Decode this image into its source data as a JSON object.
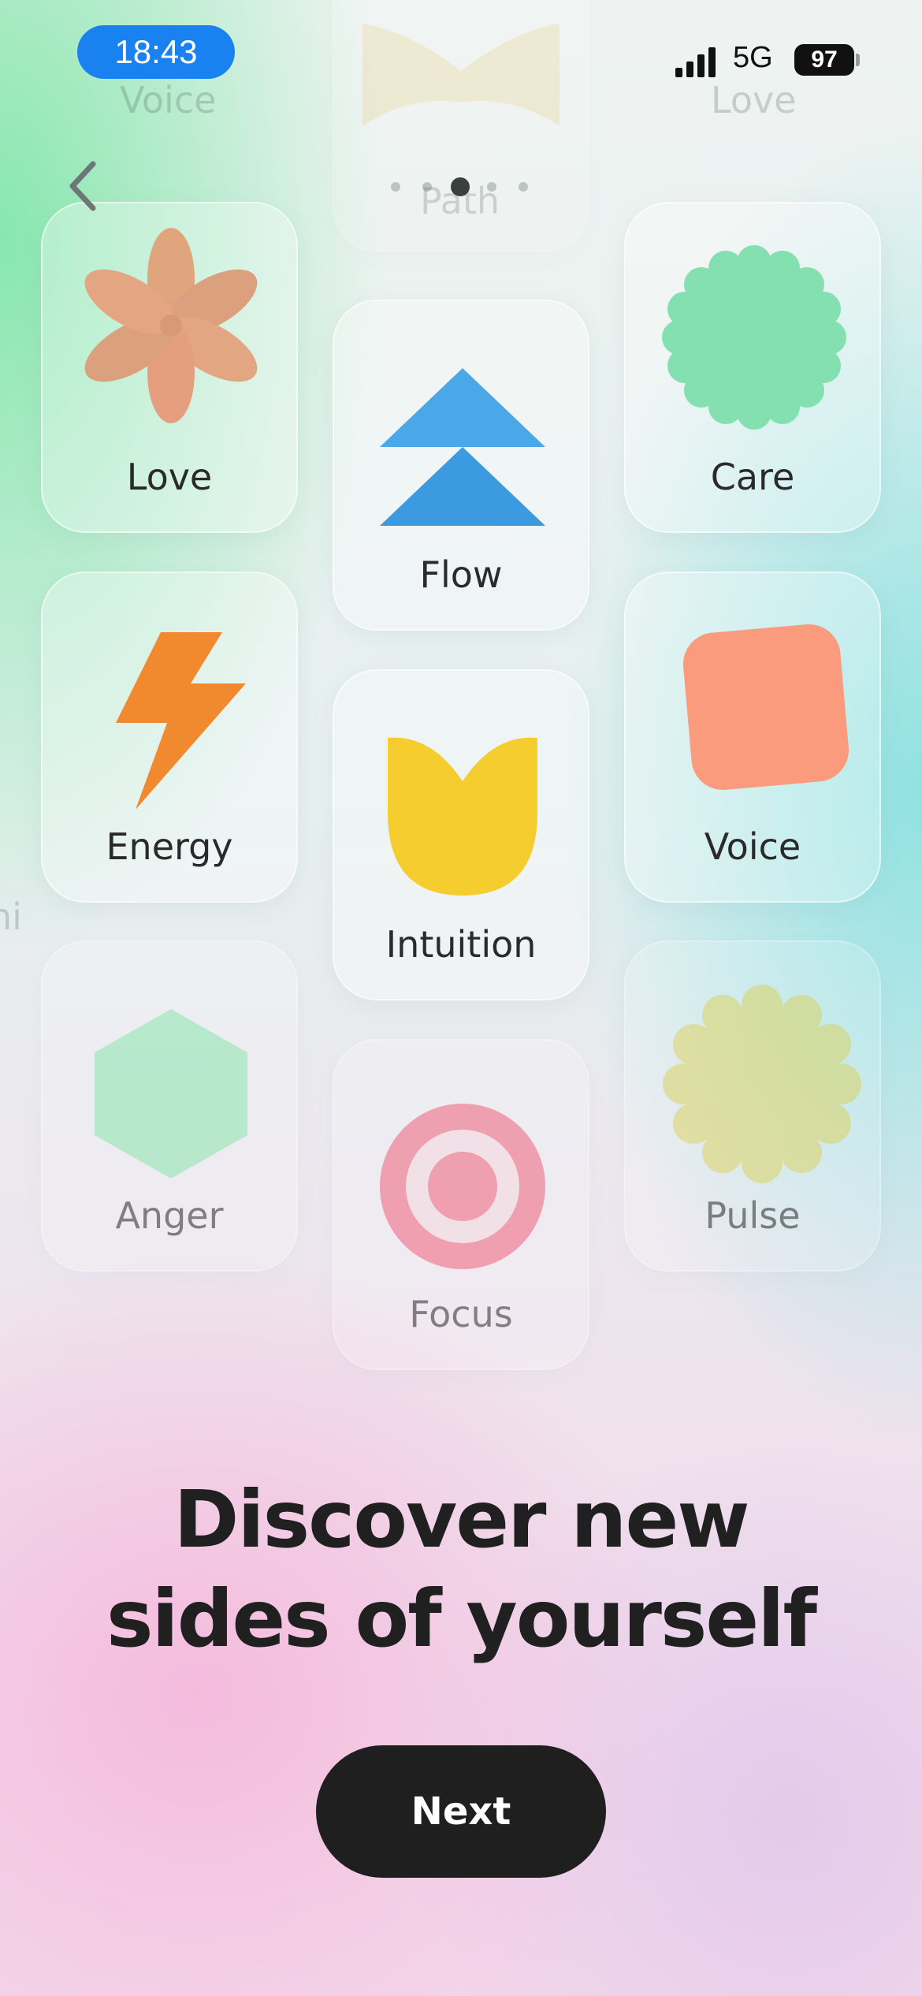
{
  "status_bar": {
    "time": "18:43",
    "network": "5G",
    "battery": "97"
  },
  "nav": {
    "back_icon": "chevron-left-icon",
    "page_count": 5,
    "active_page": 2
  },
  "ghost_labels": {
    "top_left": "Voice",
    "top_center": "Path",
    "top_right": "Love",
    "left_edge": "hi"
  },
  "cards": [
    {
      "id": "love",
      "label": "Love",
      "icon": "flower-icon",
      "color": "#e5a07a"
    },
    {
      "id": "flow",
      "label": "Flow",
      "icon": "double-triangle-icon",
      "color": "#3aa3e6"
    },
    {
      "id": "care",
      "label": "Care",
      "icon": "scalloped-circle-icon",
      "color": "#7fdcae"
    },
    {
      "id": "energy",
      "label": "Energy",
      "icon": "lightning-bolt-icon",
      "color": "#f08a2e"
    },
    {
      "id": "intuition",
      "label": "Intuition",
      "icon": "tulip-icon",
      "color": "#f7cf2c"
    },
    {
      "id": "voice",
      "label": "Voice",
      "icon": "rounded-square-icon",
      "color": "#fb9a7c"
    },
    {
      "id": "anger",
      "label": "Anger",
      "icon": "hexagon-icon",
      "color": "#8fe8b2"
    },
    {
      "id": "focus",
      "label": "Focus",
      "icon": "target-icon",
      "color": "#f2667f"
    },
    {
      "id": "pulse",
      "label": "Pulse",
      "icon": "badge-icon",
      "color": "#e5da6c"
    }
  ],
  "headline": {
    "line1": "Discover new",
    "line2": "sides of yourself"
  },
  "next_button": {
    "label": "Next",
    "bg": "#1f1f1f"
  }
}
